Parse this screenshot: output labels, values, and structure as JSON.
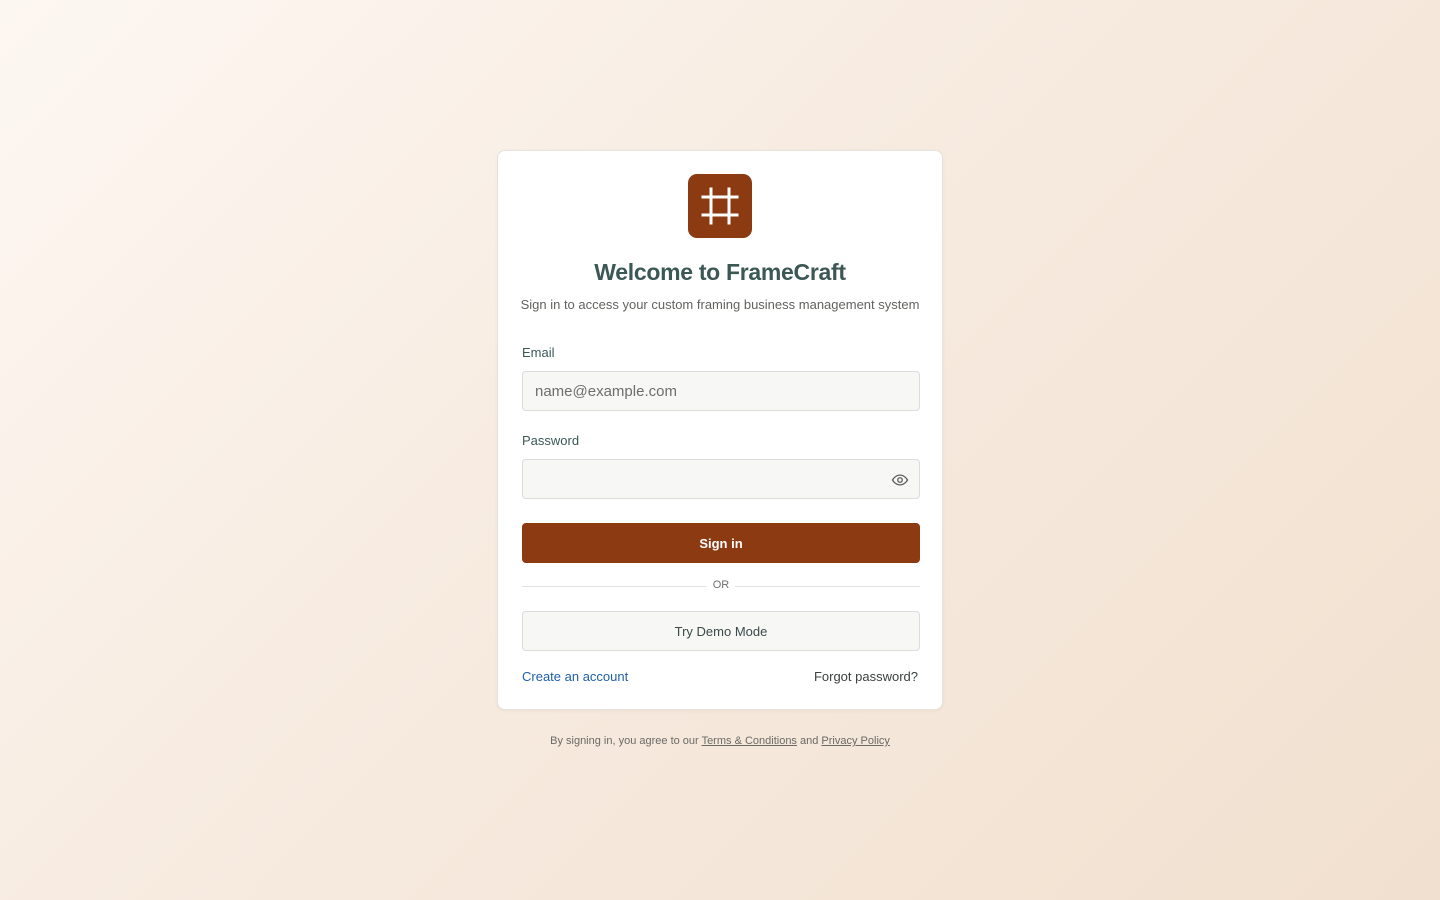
{
  "app": {
    "title": "Welcome to FrameCraft",
    "subtitle": "Sign in to access your custom framing business management system",
    "logo_icon": "frame-icon",
    "accent_color": "#8b3a12"
  },
  "form": {
    "email_label": "Email",
    "email_placeholder": "name@example.com",
    "email_value": "",
    "password_label": "Password",
    "password_value": "",
    "password_toggle_icon": "eye-icon",
    "sign_in_label": "Sign in",
    "divider_text": "OR",
    "demo_label": "Try Demo Mode",
    "create_account_label": "Create an account",
    "forgot_password_label": "Forgot password?"
  },
  "footer": {
    "prefix": "By signing in, you agree to our",
    "terms_label": "Terms & Conditions",
    "and_text": "and",
    "privacy_label": "Privacy Policy"
  }
}
